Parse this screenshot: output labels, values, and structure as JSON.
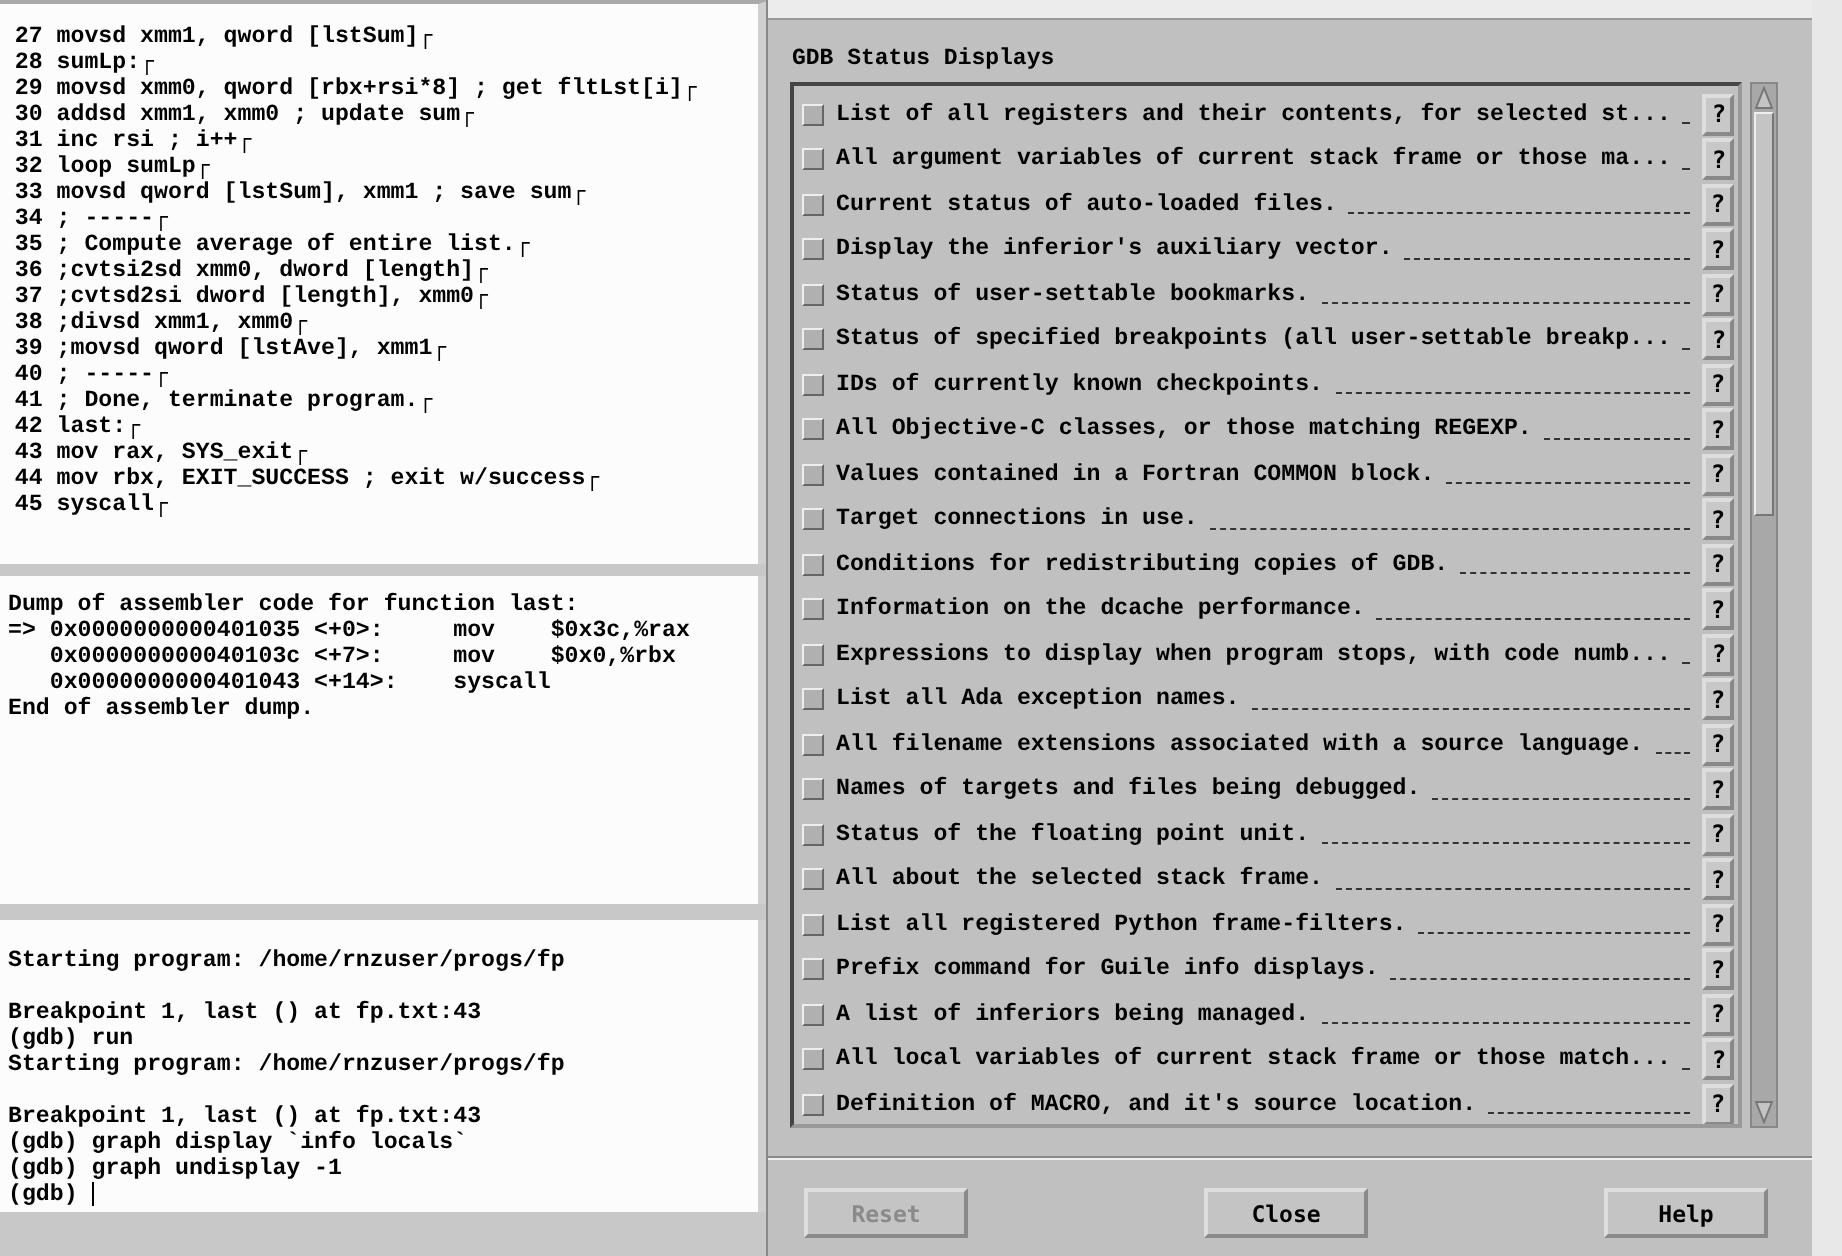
{
  "source": {
    "lines": [
      {
        "number": "27",
        "code": "movsd xmm1, qword [lstSum]┌"
      },
      {
        "number": "28",
        "code": "sumLp:┌"
      },
      {
        "number": "29",
        "code": "movsd xmm0, qword [rbx+rsi*8] ; get fltLst[i]┌"
      },
      {
        "number": "30",
        "code": "addsd xmm1, xmm0 ; update sum┌"
      },
      {
        "number": "31",
        "code": "inc rsi ; i++┌"
      },
      {
        "number": "32",
        "code": "loop sumLp┌"
      },
      {
        "number": "33",
        "code": "movsd qword [lstSum], xmm1 ; save sum┌"
      },
      {
        "number": "34",
        "code": "; -----┌"
      },
      {
        "number": "35",
        "code": "; Compute average of entire list.┌"
      },
      {
        "number": "36",
        "code": ";cvtsi2sd xmm0, dword [length]┌"
      },
      {
        "number": "37",
        "code": ";cvtsd2si dword [length], xmm0┌"
      },
      {
        "number": "38",
        "code": ";divsd xmm1, xmm0┌"
      },
      {
        "number": "39",
        "code": ";movsd qword [lstAve], xmm1┌"
      },
      {
        "number": "40",
        "code": "; -----┌"
      },
      {
        "number": "41",
        "code": "; Done, terminate program.┌"
      },
      {
        "number": "42",
        "code": "last:┌"
      },
      {
        "number": "43",
        "code": "mov rax, SYS_exit┌"
      },
      {
        "number": "44",
        "code": "mov rbx, EXIT_SUCCESS ; exit w/success┌"
      },
      {
        "number": "45",
        "code": "syscall┌"
      }
    ]
  },
  "assembler": {
    "lines": [
      "Dump of assembler code for function last:",
      "=> 0x0000000000401035 <+0>:\tmov    $0x3c,%rax",
      "   0x000000000040103c <+7>:\tmov    $0x0,%rbx",
      "   0x0000000000401043 <+14>:\tsyscall",
      "End of assembler dump."
    ]
  },
  "console": {
    "blocks": [
      [
        "Starting program: /home/rnzuser/progs/fp"
      ],
      [
        "Breakpoint 1, last () at fp.txt:43",
        "(gdb) run",
        "Starting program: /home/rnzuser/progs/fp"
      ],
      [
        "Breakpoint 1, last () at fp.txt:43",
        "(gdb) graph display `info locals`",
        "(gdb) graph undisplay -1"
      ]
    ],
    "prompt": "(gdb) "
  },
  "dialog": {
    "heading": "GDB Status Displays",
    "items": [
      {
        "label": "List of all registers and their contents, for selected st...",
        "checked": false,
        "help": "?"
      },
      {
        "label": "All argument variables of current stack frame or those ma...",
        "checked": false,
        "help": "?"
      },
      {
        "label": "Current status of auto-loaded files.",
        "checked": false,
        "help": "?"
      },
      {
        "label": "Display the inferior's auxiliary vector.",
        "checked": false,
        "help": "?"
      },
      {
        "label": "Status of user-settable bookmarks.",
        "checked": false,
        "help": "?"
      },
      {
        "label": "Status of specified breakpoints (all user-settable breakp...",
        "checked": false,
        "help": "?"
      },
      {
        "label": "IDs of currently known checkpoints.",
        "checked": false,
        "help": "?"
      },
      {
        "label": "All Objective-C classes, or those matching REGEXP.",
        "checked": false,
        "help": "?"
      },
      {
        "label": "Values contained in a Fortran COMMON block.",
        "checked": false,
        "help": "?"
      },
      {
        "label": "Target connections in use.",
        "checked": false,
        "help": "?"
      },
      {
        "label": "Conditions for redistributing copies of GDB.",
        "checked": false,
        "help": "?"
      },
      {
        "label": "Information on the dcache performance.",
        "checked": false,
        "help": "?"
      },
      {
        "label": "Expressions to display when program stops, with code numb...",
        "checked": false,
        "help": "?"
      },
      {
        "label": "List all Ada exception names.",
        "checked": false,
        "help": "?"
      },
      {
        "label": "All filename extensions associated with a source language.",
        "checked": false,
        "help": "?"
      },
      {
        "label": "Names of targets and files being debugged.",
        "checked": false,
        "help": "?"
      },
      {
        "label": "Status of the floating point unit.",
        "checked": false,
        "help": "?"
      },
      {
        "label": "All about the selected stack frame.",
        "checked": false,
        "help": "?"
      },
      {
        "label": "List all registered Python frame-filters.",
        "checked": false,
        "help": "?"
      },
      {
        "label": "Prefix command for Guile info displays.",
        "checked": false,
        "help": "?"
      },
      {
        "label": "A list of inferiors being managed.",
        "checked": false,
        "help": "?"
      },
      {
        "label": "All local variables of current stack frame or those match...",
        "checked": false,
        "help": "?"
      },
      {
        "label": "Definition of MACRO, and it's source location.",
        "checked": false,
        "help": "?"
      }
    ],
    "buttons": [
      {
        "label": "Reset",
        "disabled": true
      },
      {
        "label": "Close",
        "disabled": false
      },
      {
        "label": "Help",
        "disabled": false
      }
    ]
  }
}
